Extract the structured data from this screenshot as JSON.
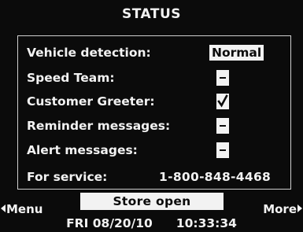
{
  "title": "STATUS",
  "status_rows": [
    {
      "label": "Vehicle detection:",
      "value": "Normal"
    },
    {
      "label": "Speed Team:",
      "state": "minus"
    },
    {
      "label": "Customer Greeter:",
      "state": "checked"
    },
    {
      "label": "Reminder messages:",
      "state": "minus"
    },
    {
      "label": "Alert messages:",
      "state": "minus"
    }
  ],
  "service": {
    "label": "For service:",
    "phone": "1-800-848-4468"
  },
  "store_status": "Store open",
  "softkeys": {
    "left": "Menu",
    "right": "More"
  },
  "footer": {
    "date": "FRI 08/20/10",
    "time": "10:33:34"
  },
  "colors": {
    "background": "#0b0b0b",
    "foreground": "#f2f2f2"
  }
}
